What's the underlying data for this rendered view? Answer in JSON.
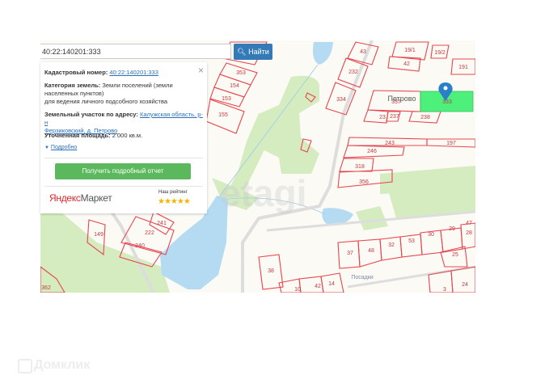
{
  "search": {
    "value": "40:22:140201:333",
    "button_label": "Найти"
  },
  "info": {
    "cadastral_label": "Кадастровый номер:",
    "cadastral_value": "40:22:140201:333",
    "category_label": "Категория земель:",
    "category_value_1": "Земли поселений (земли",
    "category_value_2": "населенных пунктов)",
    "category_value_3": "для ведения личного подсобного хозяйства",
    "address_label": "Земельный участок по адресу:",
    "address_value_1": "Калужская область, р-н",
    "address_value_2": "Ферзиковский, д. Петрово",
    "area_label": "Уточненная площадь:",
    "area_value": "2 000 кв.м.",
    "more_label": "Подробно",
    "report_button": "Получить подробный отчет",
    "close": "×"
  },
  "yandex_market": {
    "logo_y": "Яндекс",
    "logo_rest": "Маркет",
    "rating_label": "Наш рейтинг",
    "stars": 5
  },
  "map": {
    "village_label": "Петрово",
    "street_label": "Посадки",
    "watermark": "etagi",
    "colors": {
      "parcel": "#e8454f",
      "selected": "#4cf07a",
      "water": "#b5dbf2",
      "green": "#d4ecc0",
      "marker": "#2a7fc9"
    },
    "parcels": [
      "43",
      "19/1",
      "19/2",
      "42",
      "191",
      "232",
      "334",
      "337",
      "333",
      "23",
      "237",
      "238",
      "243",
      "197",
      "246",
      "318",
      "356",
      "353",
      "154",
      "153",
      "155",
      "241",
      "222",
      "240",
      "149",
      "362",
      "37",
      "48",
      "32",
      "53",
      "30",
      "29",
      "47",
      "28",
      "25",
      "38",
      "14",
      "42",
      "10",
      "3",
      "24"
    ]
  },
  "footer": {
    "brand": "Домклик"
  }
}
